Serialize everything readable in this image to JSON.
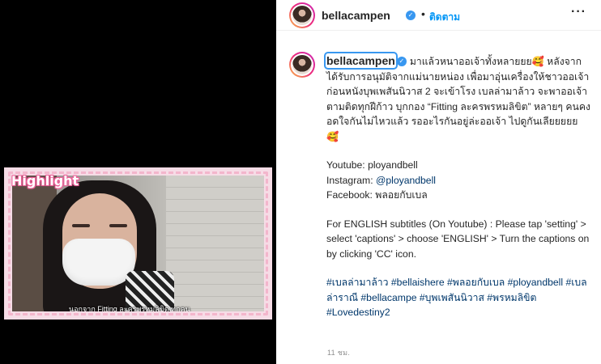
{
  "video": {
    "badge": "Highlight",
    "subtitle": "นอกจาก Fitting ละครพรหมลิขิต ทุกคน"
  },
  "header": {
    "username": "bellacampen",
    "follow_label": "ติดตาม",
    "more_label": "···",
    "separator": "•"
  },
  "caption": {
    "username": "bellacampen",
    "text": "มาแล้วหนาออเจ้าทั้งหลายยย🥰 หลังจากได้รับการอนุมัติจากแม่นายหน่อง เพื่อมาอุ่นเครื่องให้ชาวออเจ้าก่อนหนังบุพเพสันนิวาส 2 จะเข้าโรง เบลล่ามาล้าว จะพาออเจ้าตามติดทุกฝีก้าว บุกกอง “Fitting ละครพรหมลิขิต” หลายๆ คนคงอดใจกันไม่ไหวแล้ว รออะไรกันอยู่ล่ะออเจ้า ไปดูกันเลียยยยย 🥰",
    "youtube_label": "Youtube: ",
    "youtube_value": "ployandbell",
    "instagram_label": "Instagram: ",
    "instagram_value": "@ployandbell",
    "facebook_label": "Facebook: ",
    "facebook_value": "พลอยกับเบล",
    "english_note": "For ENGLISH subtitles (On Youtube) : Please tap 'setting' > select 'captions' > choose 'ENGLISH' > Turn the captions on by clicking 'CC' icon.",
    "hashtags": [
      "#เบลล่ามาล้าว",
      "#bellaishere",
      "#พลอยกับเบล",
      "#ployandbell",
      "#เบลล่าราณี",
      "#bellacampe",
      "#บุพเพสันนิวาส",
      "#พรหมลิขิต",
      "#Lovedestiny2"
    ]
  },
  "timestamp": "11 ชม.",
  "colors": {
    "accent_blue": "#0095f6",
    "verified_blue": "#3897f0",
    "link": "#00376b",
    "muted": "#8e8e8e",
    "highlight_pink": "#ee5e98"
  },
  "icons": {
    "verified": "verified-badge-icon",
    "more": "more-options-icon"
  }
}
